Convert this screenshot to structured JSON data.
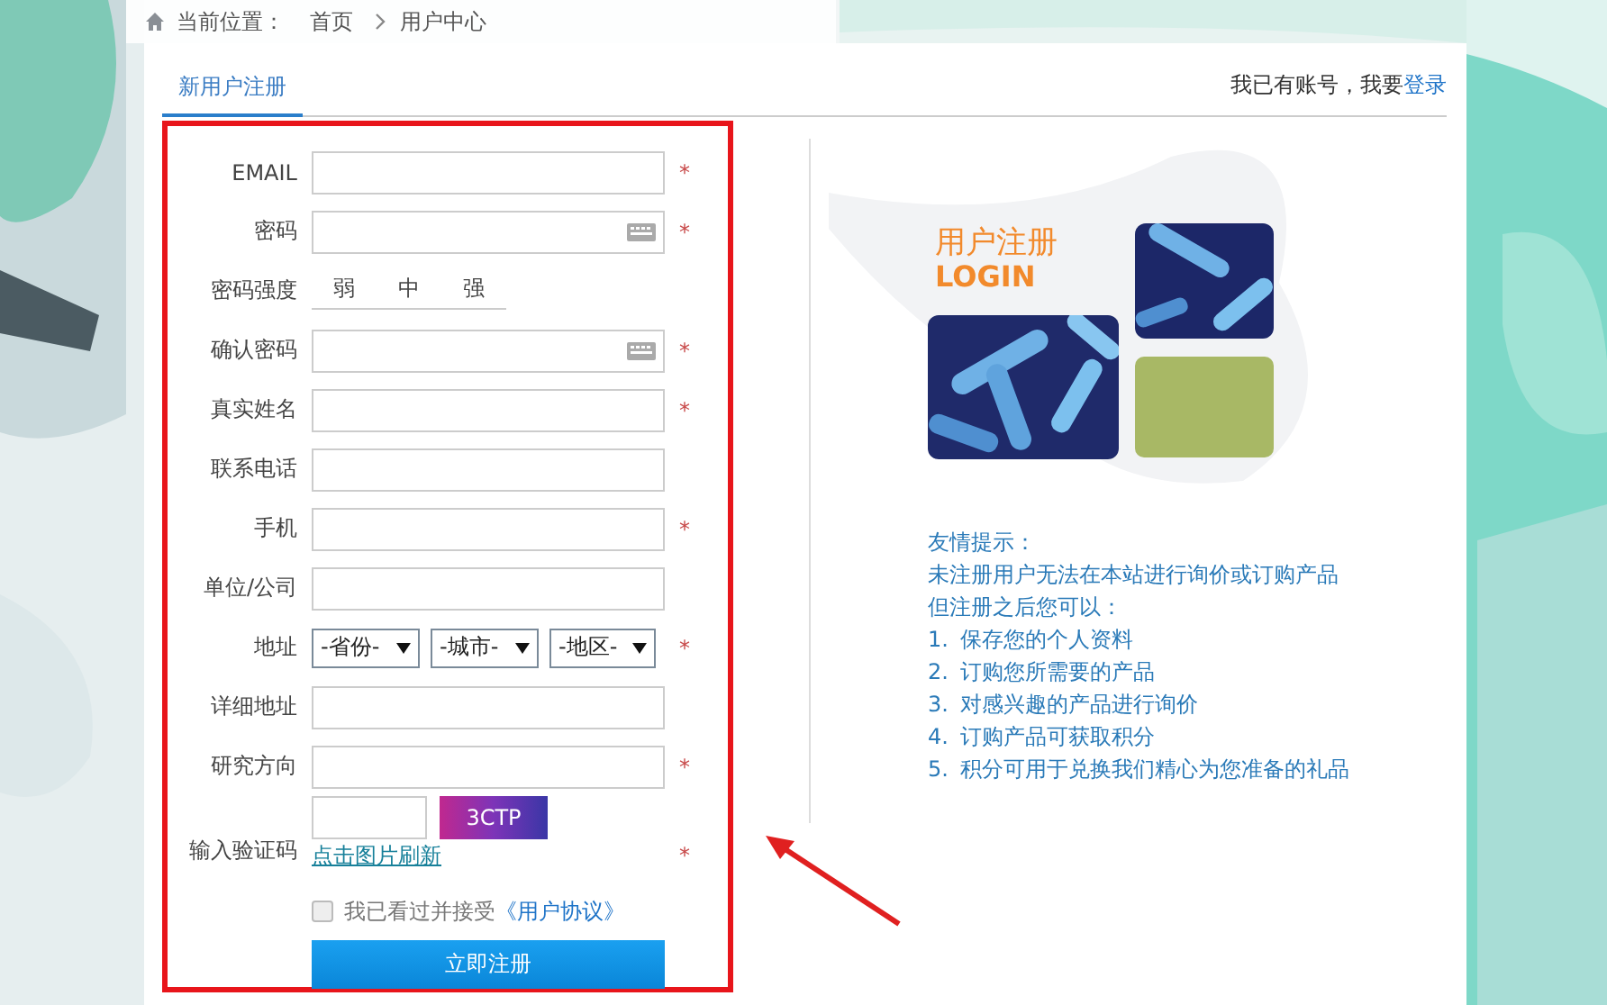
{
  "breadcrumb": {
    "label": "当前位置：",
    "items": [
      "首页",
      "用户中心"
    ]
  },
  "tabs": [
    {
      "label": "新用户注册",
      "selected": true
    }
  ],
  "login_prompt": {
    "text": "我已有账号，我要",
    "link": "登录"
  },
  "form": {
    "fields": [
      {
        "kind": "text",
        "label": "EMAIL",
        "required": true
      },
      {
        "kind": "password",
        "label": "密码",
        "required": true
      },
      {
        "kind": "strength",
        "label": "密码强度",
        "levels": [
          "弱",
          "中",
          "强"
        ]
      },
      {
        "kind": "password",
        "label": "确认密码",
        "required": true
      },
      {
        "kind": "text",
        "label": "真实姓名",
        "required": true
      },
      {
        "kind": "text",
        "label": "联系电话",
        "required": false
      },
      {
        "kind": "text",
        "label": "手机",
        "required": true
      },
      {
        "kind": "text",
        "label": "单位/公司",
        "required": false
      },
      {
        "kind": "select",
        "label": "地址",
        "required": true,
        "options": [
          "-省份-",
          "-城市-",
          "-地区-"
        ]
      },
      {
        "kind": "text",
        "label": "详细地址",
        "required": false
      },
      {
        "kind": "text",
        "label": "研究方向",
        "required": true
      },
      {
        "kind": "captcha",
        "label": "输入验证码",
        "required": true,
        "code": "3CTP",
        "refresh": "点击图片刷新"
      }
    ],
    "required_mark": "*",
    "agreement": {
      "checked": false,
      "text": "我已看过并接受",
      "link": "《用户协议》"
    },
    "submit": "立即注册"
  },
  "promo": {
    "title": "用户注册",
    "subtitle": "LOGIN"
  },
  "tips": {
    "heading": "友情提示：",
    "lines": [
      "未注册用户无法在本站进行询价或订购产品",
      "但注册之后您可以："
    ],
    "items": [
      {
        "number": "1.",
        "text": "保存您的个人资料"
      },
      {
        "number": "2.",
        "text": "订购您所需要的产品"
      },
      {
        "number": "3.",
        "text": "对感兴趣的产品进行询价"
      },
      {
        "number": "4.",
        "text": "订购产品可获取积分"
      },
      {
        "number": "5.",
        "text": "积分可用于兑换我们精心为您准备的礼品"
      }
    ]
  }
}
